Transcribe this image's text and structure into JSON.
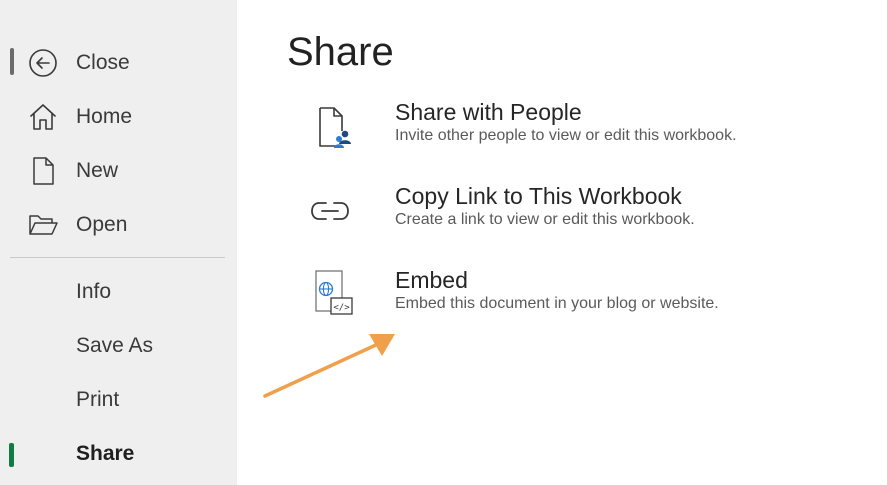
{
  "sidebar": {
    "items": [
      {
        "label": "Close",
        "icon": "back-arrow-icon"
      },
      {
        "label": "Home",
        "icon": "home-icon"
      },
      {
        "label": "New",
        "icon": "new-document-icon"
      },
      {
        "label": "Open",
        "icon": "folder-open-icon"
      },
      {
        "label": "Info"
      },
      {
        "label": "Save As"
      },
      {
        "label": "Print"
      },
      {
        "label": "Share",
        "active": true
      }
    ]
  },
  "main": {
    "title": "Share",
    "options": [
      {
        "title": "Share with People",
        "description": "Invite other people to view or edit this workbook.",
        "icon": "share-people-icon"
      },
      {
        "title": "Copy Link to This Workbook",
        "description": "Create a link to view or edit this workbook.",
        "icon": "link-icon"
      },
      {
        "title": "Embed",
        "description": "Embed this document in your blog or website.",
        "icon": "embed-icon"
      }
    ]
  },
  "annotation": {
    "icon": "pointer-arrow",
    "color": "#f0a04b"
  },
  "colors": {
    "sidebar_bg": "#efefef",
    "active_indicator": "#107c41",
    "accent_blue": "#2b7cd3"
  }
}
